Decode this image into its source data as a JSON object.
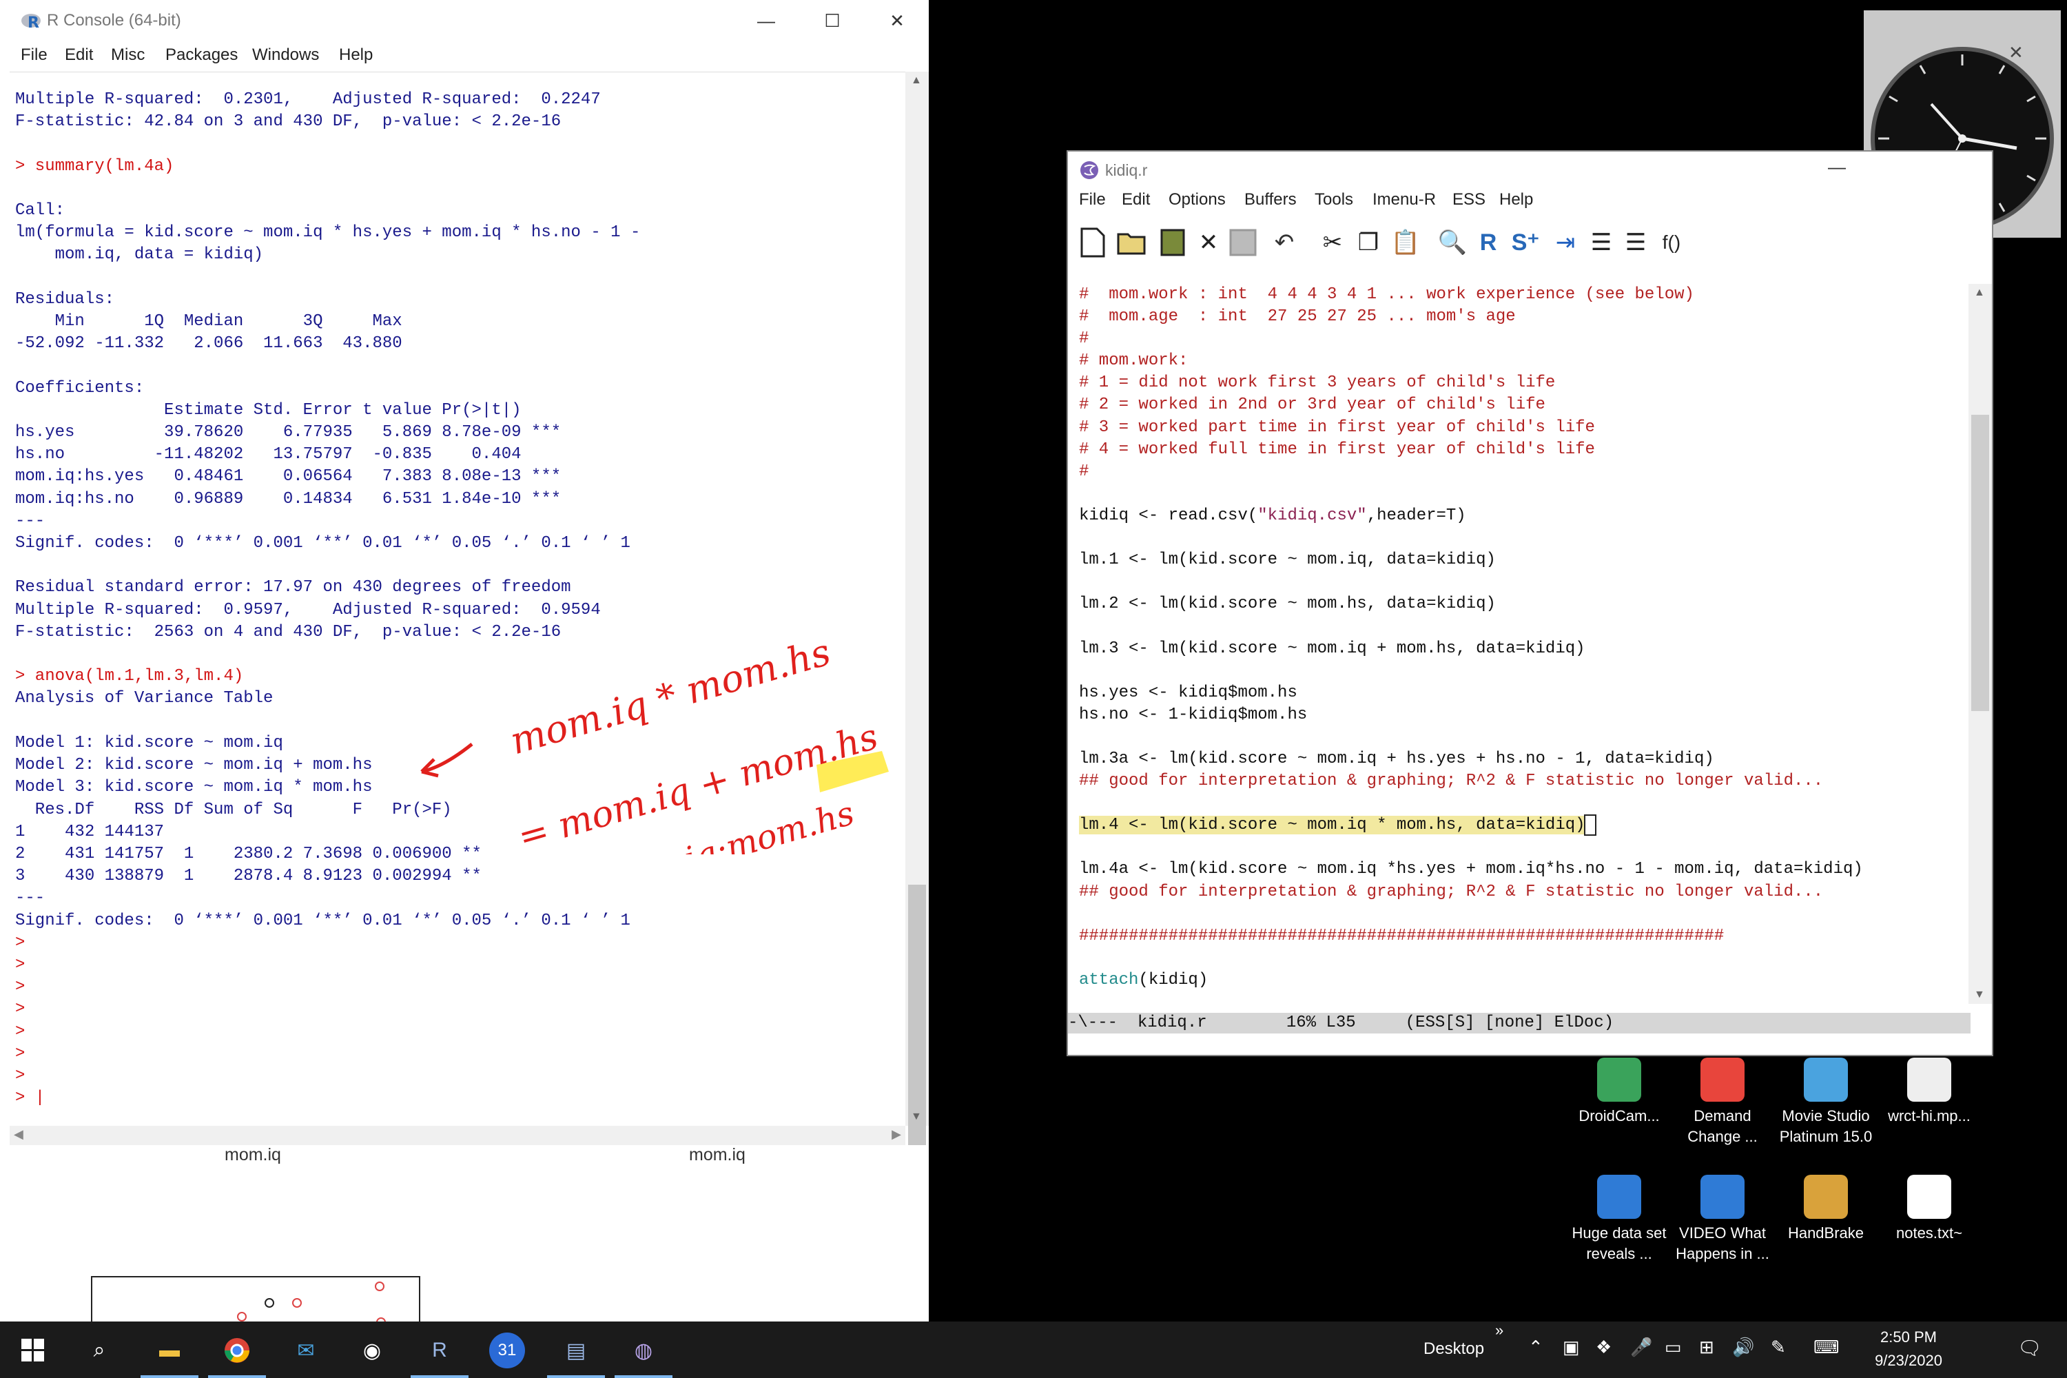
{
  "rconsole": {
    "title": "R Console (64-bit)",
    "menu": [
      "File",
      "Edit",
      "Misc",
      "Packages",
      "Windows",
      "Help"
    ],
    "lines": [
      {
        "t": "Multiple R-squared:  0.2301,    Adjusted R-squared:  0.2247",
        "in": false
      },
      {
        "t": "F-statistic: 42.84 on 3 and 430 DF,  p-value: < 2.2e-16",
        "in": false
      },
      {
        "t": "",
        "in": false
      },
      {
        "t": "> summary(lm.4a)",
        "in": true
      },
      {
        "t": "",
        "in": false
      },
      {
        "t": "Call:",
        "in": false
      },
      {
        "t": "lm(formula = kid.score ~ mom.iq * hs.yes + mom.iq * hs.no - 1 -",
        "in": false
      },
      {
        "t": "    mom.iq, data = kidiq)",
        "in": false
      },
      {
        "t": "",
        "in": false
      },
      {
        "t": "Residuals:",
        "in": false
      },
      {
        "t": "    Min      1Q  Median      3Q     Max",
        "in": false
      },
      {
        "t": "-52.092 -11.332   2.066  11.663  43.880",
        "in": false
      },
      {
        "t": "",
        "in": false
      },
      {
        "t": "Coefficients:",
        "in": false
      },
      {
        "t": "               Estimate Std. Error t value Pr(>|t|)",
        "in": false
      },
      {
        "t": "hs.yes         39.78620    6.77935   5.869 8.78e-09 ***",
        "in": false
      },
      {
        "t": "hs.no         -11.48202   13.75797  -0.835    0.404",
        "in": false
      },
      {
        "t": "mom.iq:hs.yes   0.48461    0.06564   7.383 8.08e-13 ***",
        "in": false
      },
      {
        "t": "mom.iq:hs.no    0.96889    0.14834   6.531 1.84e-10 ***",
        "in": false
      },
      {
        "t": "---",
        "in": false
      },
      {
        "t": "Signif. codes:  0 ‘***’ 0.001 ‘**’ 0.01 ‘*’ 0.05 ‘.’ 0.1 ‘ ’ 1",
        "in": false
      },
      {
        "t": "",
        "in": false
      },
      {
        "t": "Residual standard error: 17.97 on 430 degrees of freedom",
        "in": false
      },
      {
        "t": "Multiple R-squared:  0.9597,    Adjusted R-squared:  0.9594",
        "in": false
      },
      {
        "t": "F-statistic:  2563 on 4 and 430 DF,  p-value: < 2.2e-16",
        "in": false
      },
      {
        "t": "",
        "in": false
      },
      {
        "t": "> anova(lm.1,lm.3,lm.4)",
        "in": true
      },
      {
        "t": "Analysis of Variance Table",
        "in": false
      },
      {
        "t": "",
        "in": false
      },
      {
        "t": "Model 1: kid.score ~ mom.iq",
        "in": false
      },
      {
        "t": "Model 2: kid.score ~ mom.iq + mom.hs",
        "in": false
      },
      {
        "t": "Model 3: kid.score ~ mom.iq * mom.hs",
        "in": false
      },
      {
        "t": "  Res.Df    RSS Df Sum of Sq      F   Pr(>F)",
        "in": false
      },
      {
        "t": "1    432 144137",
        "in": false
      },
      {
        "t": "2    431 141757  1    2380.2 7.3698 0.006900 **",
        "in": false
      },
      {
        "t": "3    430 138879  1    2878.4 8.9123 0.002994 **",
        "in": false
      },
      {
        "t": "---",
        "in": false
      },
      {
        "t": "Signif. codes:  0 ‘***’ 0.001 ‘**’ 0.01 ‘*’ 0.05 ‘.’ 0.1 ‘ ’ 1",
        "in": false
      },
      {
        "t": ">",
        "in": true
      },
      {
        "t": ">",
        "in": true
      },
      {
        "t": ">",
        "in": true
      },
      {
        "t": ">",
        "in": true
      },
      {
        "t": ">",
        "in": true
      },
      {
        "t": ">",
        "in": true
      },
      {
        "t": ">",
        "in": true
      },
      {
        "t": "> |",
        "in": true
      }
    ],
    "plot_labels": [
      "mom.iq",
      "mom.iq"
    ]
  },
  "annotation": {
    "line1": "mom.iq * mom.hs",
    "line2": "= mom.iq + mom.hs",
    "line3": "+ mom.iq:mom.hs"
  },
  "emacs": {
    "title": "kidiq.r",
    "menu": [
      "File",
      "Edit",
      "Options",
      "Buffers",
      "Tools",
      "Imenu-R",
      "ESS",
      "Help"
    ],
    "code_lines": [
      [
        {
          "t": "#  mom.work : int  4 4 4 3 4 1 ... work experience (see below)",
          "c": "c"
        }
      ],
      [
        {
          "t": "#  mom.age  : int  27 25 27 25 ... mom's age",
          "c": "c"
        }
      ],
      [
        {
          "t": "#",
          "c": "c"
        }
      ],
      [
        {
          "t": "# mom.work:",
          "c": "c"
        }
      ],
      [
        {
          "t": "# 1 = did not work first 3 years of child's life",
          "c": "c"
        }
      ],
      [
        {
          "t": "# 2 = worked in 2nd or 3rd year of child's life",
          "c": "c"
        }
      ],
      [
        {
          "t": "# 3 = worked part time in first year of child's life",
          "c": "c"
        }
      ],
      [
        {
          "t": "# 4 = worked full time in first year of child's life",
          "c": "c"
        }
      ],
      [
        {
          "t": "#",
          "c": "c"
        }
      ],
      [
        {
          "t": "",
          "c": ""
        }
      ],
      [
        {
          "t": "kidiq <- read.csv(",
          "c": ""
        },
        {
          "t": "\"kidiq.csv\"",
          "c": "s"
        },
        {
          "t": ",header=T)",
          "c": ""
        }
      ],
      [
        {
          "t": "",
          "c": ""
        }
      ],
      [
        {
          "t": "lm.1 <- lm(kid.score ~ mom.iq, data=kidiq)",
          "c": ""
        }
      ],
      [
        {
          "t": "",
          "c": ""
        }
      ],
      [
        {
          "t": "lm.2 <- lm(kid.score ~ mom.hs, data=kidiq)",
          "c": ""
        }
      ],
      [
        {
          "t": "",
          "c": ""
        }
      ],
      [
        {
          "t": "lm.3 <- lm(kid.score ~ mom.iq + mom.hs, data=kidiq)",
          "c": ""
        }
      ],
      [
        {
          "t": "",
          "c": ""
        }
      ],
      [
        {
          "t": "hs.yes <- kidiq$mom.hs",
          "c": ""
        }
      ],
      [
        {
          "t": "hs.no <- 1-kidiq$mom.hs",
          "c": ""
        }
      ],
      [
        {
          "t": "",
          "c": ""
        }
      ],
      [
        {
          "t": "lm.3a <- lm(kid.score ~ mom.iq + hs.yes + hs.no - 1, data=kidiq)",
          "c": ""
        }
      ],
      [
        {
          "t": "## good for interpretation & graphing; R^2 & F statistic no longer valid...",
          "c": "c"
        }
      ],
      [
        {
          "t": "",
          "c": ""
        }
      ],
      [
        {
          "t": "lm.4 <- lm(kid.score ~ mom.iq * mom.hs, data=kidiq)",
          "c": "hl"
        },
        {
          "t": " ",
          "c": "cursor"
        }
      ],
      [
        {
          "t": "",
          "c": ""
        }
      ],
      [
        {
          "t": "lm.4a <- lm(kid.score ~ mom.iq *hs.yes + mom.iq*hs.no - 1 - mom.iq, data=kidiq)",
          "c": ""
        }
      ],
      [
        {
          "t": "## good for interpretation & graphing; R^2 & F statistic no longer valid...",
          "c": "c"
        }
      ],
      [
        {
          "t": "",
          "c": ""
        }
      ],
      [
        {
          "t": "#################################################################",
          "c": "c"
        }
      ],
      [
        {
          "t": "",
          "c": ""
        }
      ],
      [
        {
          "t": "attach",
          "c": "k"
        },
        {
          "t": "(kidiq)",
          "c": ""
        }
      ]
    ],
    "modeline": "-\\---  kidiq.r        16% L35     (ESS[S] [none] ElDoc)"
  },
  "desktop_icons": [
    {
      "label": "DroidCam...",
      "color": "#3aa35b"
    },
    {
      "label": "Demand Change ...",
      "color": "#e8453c"
    },
    {
      "label": "Movie Studio Platinum 15.0",
      "color": "#4aa3df"
    },
    {
      "label": "wrct-hi.mp...",
      "color": "#eeeeee"
    },
    {
      "label": "Huge data set reveals ...",
      "color": "#2f7bd6"
    },
    {
      "label": "VIDEO What Happens in ...",
      "color": "#2f7bd6"
    },
    {
      "label": "HandBrake",
      "color": "#d9a23b"
    },
    {
      "label": "notes.txt~",
      "color": "#ffffff"
    }
  ],
  "taskbar": {
    "desktop_label": "Desktop",
    "time": "2:50 PM",
    "date": "9/23/2020"
  }
}
